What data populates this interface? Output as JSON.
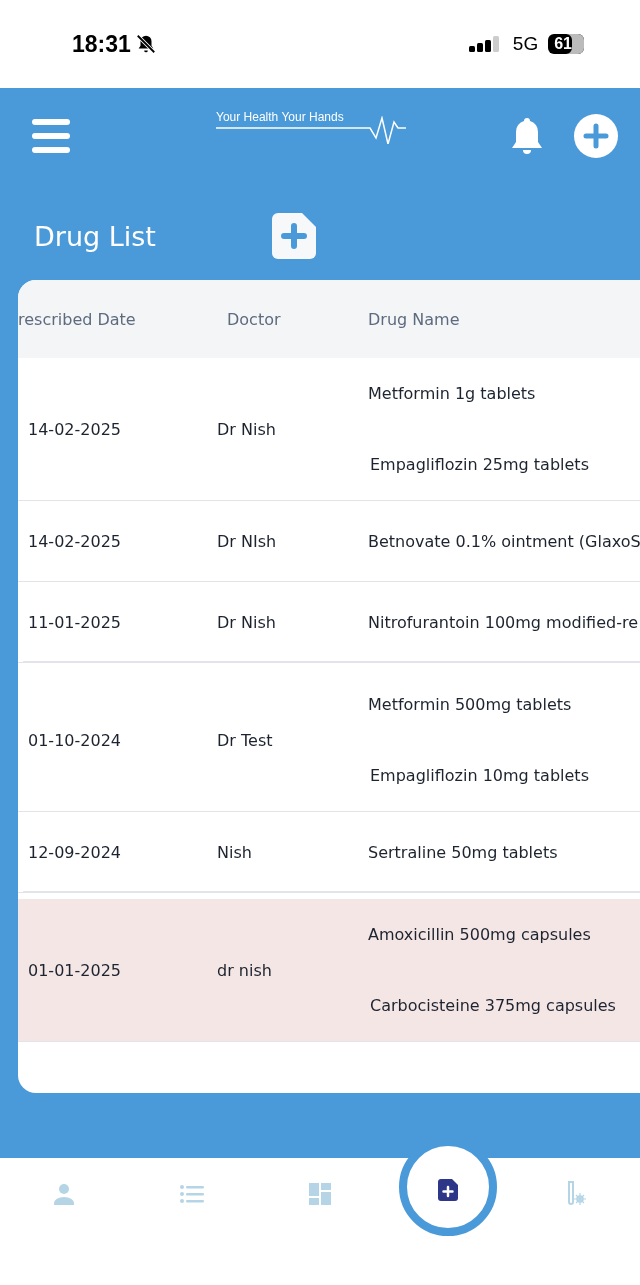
{
  "status_bar": {
    "time": "18:31",
    "network": "5G",
    "battery": "61"
  },
  "header": {
    "logo": "Your Health Your Hands"
  },
  "page_title": "Drug List",
  "table": {
    "columns": [
      "rescribed Date",
      "Doctor",
      "Drug Name"
    ],
    "rows": [
      {
        "date": "14-02-2025",
        "doctor": "Dr Nish",
        "drugs": [
          "Metformin 1g tablets",
          "Empagliflozin 25mg tablets"
        ],
        "highlighted": false
      },
      {
        "date": "14-02-2025",
        "doctor": "Dr NIsh",
        "drugs": [
          "Betnovate 0.1% ointment (GlaxoS"
        ],
        "highlighted": false
      },
      {
        "date": "11-01-2025",
        "doctor": "Dr Nish",
        "drugs": [
          "Nitrofurantoin 100mg modified-re"
        ],
        "highlighted": false
      },
      {
        "date": "01-10-2024",
        "doctor": "Dr Test",
        "drugs": [
          "Metformin 500mg tablets",
          "Empagliflozin 10mg tablets"
        ],
        "highlighted": false
      },
      {
        "date": "12-09-2024",
        "doctor": "Nish",
        "drugs": [
          "Sertraline 50mg tablets"
        ],
        "highlighted": false
      },
      {
        "date": "01-01-2025",
        "doctor": "dr nish",
        "drugs": [
          "Amoxicillin 500mg capsules",
          "Carbocisteine 375mg capsules"
        ],
        "highlighted": true
      }
    ]
  },
  "bottom_nav": [
    {
      "kind": "profile",
      "selected": false
    },
    {
      "kind": "list",
      "selected": false
    },
    {
      "kind": "dashboard",
      "selected": false
    },
    {
      "kind": "add-document",
      "selected": true
    },
    {
      "kind": "test-tube",
      "selected": false
    }
  ]
}
